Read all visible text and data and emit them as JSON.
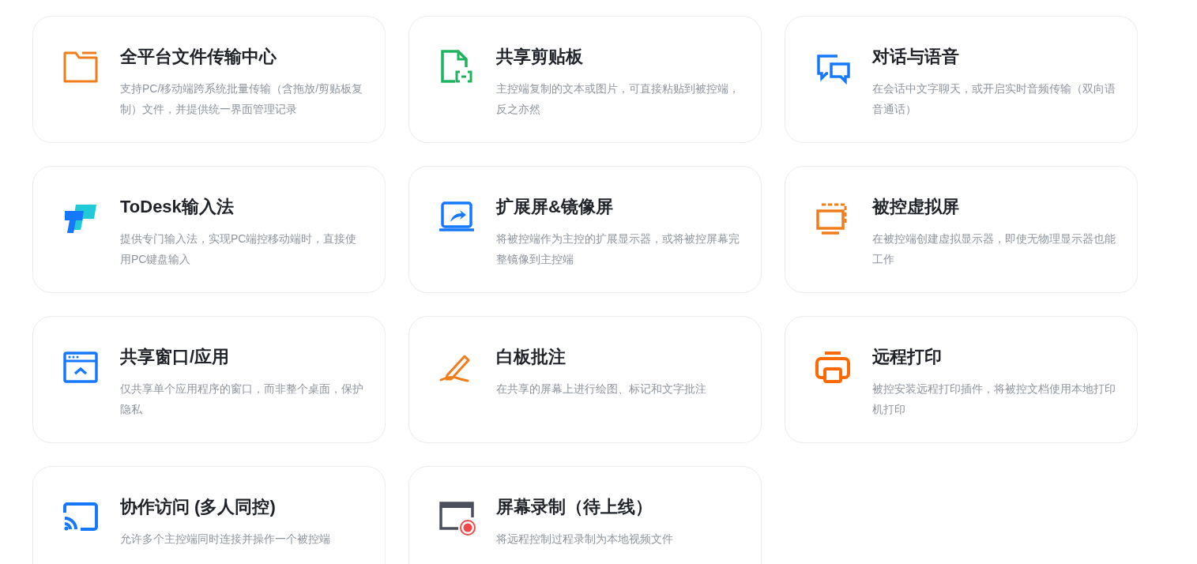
{
  "features": [
    {
      "kind": "folder",
      "title": "全平台文件传输中心",
      "description": "支持PC/移动端跨系统批量传输（含拖放/剪贴板复制）文件，并提供统一界面管理记录"
    },
    {
      "kind": "clipboard",
      "title": "共享剪贴板",
      "description": "主控端复制的文本或图片，可直接粘贴到被控端，反之亦然"
    },
    {
      "kind": "chat",
      "title": "对话与语音",
      "description": "在会话中文字聊天，或开启实时音频传输（双向语音通话）"
    },
    {
      "kind": "logo",
      "title": "ToDesk输入法",
      "description": "提供专门输入法，实现PC端控移动端时，直接使用PC键盘输入"
    },
    {
      "kind": "extend",
      "title": "扩展屏&镜像屏",
      "description": "将被控端作为主控的扩展显示器，或将被控屏幕完整镜像到主控端"
    },
    {
      "kind": "virtual",
      "title": "被控虚拟屏",
      "description": "在被控端创建虚拟显示器，即使无物理显示器也能工作"
    },
    {
      "kind": "window",
      "title": "共享窗口/应用",
      "description": "仅共享单个应用程序的窗口，而非整个桌面，保护隐私"
    },
    {
      "kind": "pen",
      "title": "白板批注",
      "description": "在共享的屏幕上进行绘图、标记和文字批注"
    },
    {
      "kind": "printer",
      "title": "远程打印",
      "description": "被控安装远程打印插件，将被控文档使用本地打印机打印"
    },
    {
      "kind": "cast",
      "title": "协作访问 (多人同控)",
      "description": "允许多个主控端同时连接并操作一个被控端"
    },
    {
      "kind": "record",
      "title": "屏幕录制（待上线）",
      "description": "将远程控制过程录制为本地视频文件"
    }
  ]
}
